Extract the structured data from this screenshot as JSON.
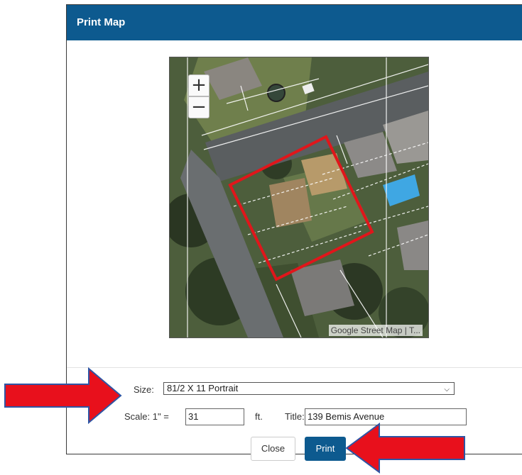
{
  "dialog": {
    "title": "Print Map"
  },
  "map": {
    "attribution": "Google Street Map | T...",
    "zoom_in_label": "+",
    "zoom_out_label": "−"
  },
  "form": {
    "size_label": "Size:",
    "size_value": "81/2 X 11 Portrait",
    "scale_label": "Scale: 1\" =",
    "scale_value": "31",
    "scale_unit": "ft.",
    "title_label": "Title:",
    "title_value": "139 Bemis Avenue"
  },
  "buttons": {
    "close_label": "Close",
    "print_label": "Print"
  },
  "colors": {
    "header": "#0d5a8f",
    "print_button": "#0d5a8f",
    "highlight_box": "#e0161b",
    "annotation_arrow": "#e8101c"
  }
}
